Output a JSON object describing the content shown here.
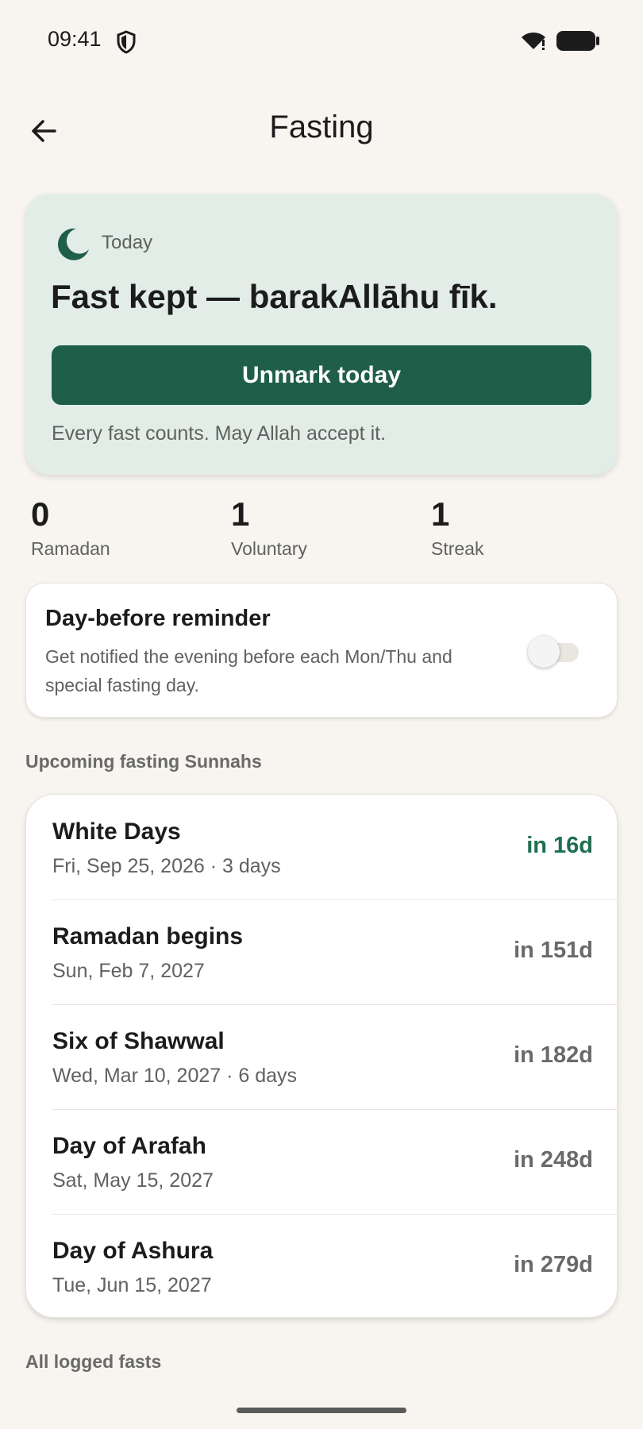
{
  "status_bar": {
    "time": "09:41"
  },
  "header": {
    "title": "Fasting"
  },
  "today": {
    "label": "Today",
    "status": "Fast kept — barakAllāhu fīk.",
    "button_label": "Unmark today",
    "note": "Every fast counts. May Allah accept it."
  },
  "stats": [
    {
      "value": "0",
      "label": "Ramadan"
    },
    {
      "value": "1",
      "label": "Voluntary"
    },
    {
      "value": "1",
      "label": "Streak"
    }
  ],
  "reminder": {
    "title": "Day-before reminder",
    "description": "Get notified the evening before each Mon/Thu and special fasting day.",
    "enabled": false
  },
  "upcoming": {
    "section_label": "Upcoming fasting Sunnahs",
    "items": [
      {
        "name": "White Days",
        "date": "Fri, Sep 25, 2026 · 3 days",
        "countdown": "in 16d"
      },
      {
        "name": "Ramadan begins",
        "date": "Sun, Feb 7, 2027",
        "countdown": "in 151d"
      },
      {
        "name": "Six of Shawwal",
        "date": "Wed, Mar 10, 2027 · 6 days",
        "countdown": "in 182d"
      },
      {
        "name": "Day of Arafah",
        "date": "Sat, May 15, 2027",
        "countdown": "in 248d"
      },
      {
        "name": "Day of Ashura",
        "date": "Tue, Jun 15, 2027",
        "countdown": "in 279d"
      }
    ]
  },
  "logged": {
    "section_label": "All logged fasts"
  },
  "colors": {
    "accent": "#1f5e48",
    "card_bg": "#e2ede8",
    "page_bg": "#f8f5f0",
    "next_countdown": "#1f6e50"
  }
}
